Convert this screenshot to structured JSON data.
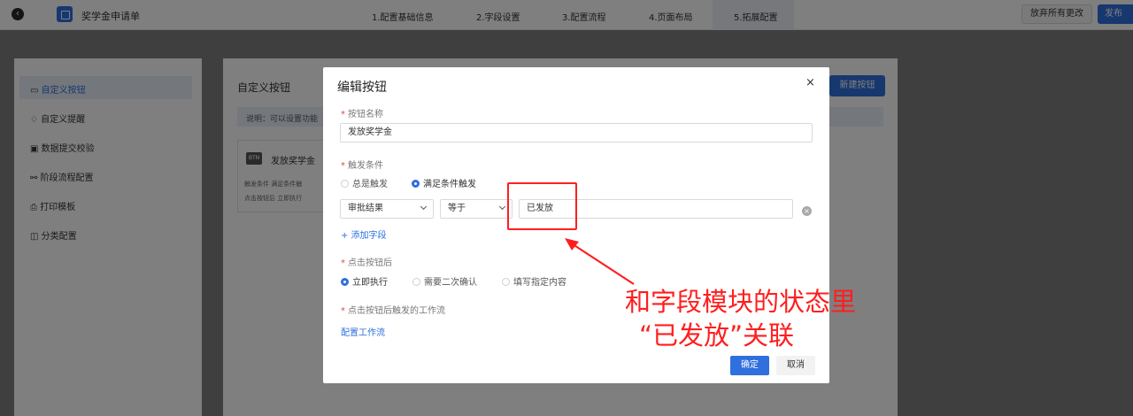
{
  "header": {
    "back_icon": "back-arrow-icon",
    "app_title": "奖学金申请单",
    "steps": [
      "1.配置基础信息",
      "2.字段设置",
      "3.配置流程",
      "4.页面布局",
      "5.拓展配置"
    ],
    "active_step": 4,
    "discard_label": "放弃所有更改",
    "publish_label": "发布"
  },
  "sidebar": {
    "items": [
      {
        "label": "自定义按钮",
        "icon": "button-icon"
      },
      {
        "label": "自定义提醒",
        "icon": "bell-icon"
      },
      {
        "label": "数据提交校验",
        "icon": "check-doc-icon"
      },
      {
        "label": "阶段流程配置",
        "icon": "flow-icon"
      },
      {
        "label": "打印模板",
        "icon": "printer-icon"
      },
      {
        "label": "分类配置",
        "icon": "category-icon"
      }
    ],
    "active_index": 0
  },
  "main": {
    "title": "自定义按钮",
    "notice": "说明：可以设置功能",
    "new_button_label": "新建按钮",
    "card": {
      "icon_text": "BTN",
      "name": "发放奖学金",
      "line1": "触发条件  满足条件触",
      "line2": "点击按钮后  立即执行"
    }
  },
  "modal": {
    "title": "编辑按钮",
    "close": "×",
    "name_label": "按钮名称",
    "name_value": "发放奖学金",
    "trigger_label": "触发条件",
    "trigger_options": [
      "总是触发",
      "满足条件触发"
    ],
    "trigger_selected": 1,
    "condition": {
      "field": "审批结果",
      "operator": "等于",
      "value": "已发放"
    },
    "add_field_label": "+ 添加字段",
    "after_click_label": "点击按钮后",
    "after_click_options": [
      "立即执行",
      "需要二次确认",
      "填写指定内容"
    ],
    "after_click_selected": 0,
    "workflow_label": "点击按钮后触发的工作流",
    "configure_workflow_label": "配置工作流",
    "ok_label": "确定",
    "cancel_label": "取消"
  },
  "annotation": {
    "line1": "和字段模块的状态里",
    "line2": "“已发放”关联",
    "color": "#ff1e1e"
  },
  "colors": {
    "accent": "#2f6fde",
    "overlay": "rgba(0,0,0,0.5)"
  }
}
